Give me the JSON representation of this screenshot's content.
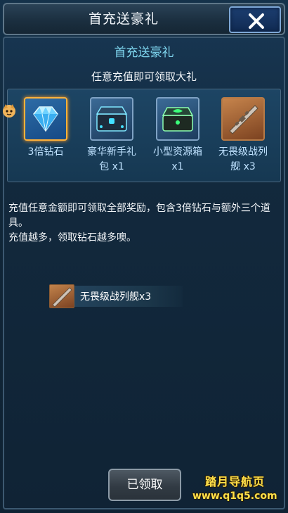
{
  "header": {
    "title": "首充送豪礼",
    "close_icon": "close-icon"
  },
  "main": {
    "subtitle": "首充送豪礼",
    "tagline": "任意充值即可领取大礼",
    "rewards": [
      {
        "label_line1": "3倍钻石",
        "label_line2": "",
        "icon": "diamond-icon",
        "selected": true
      },
      {
        "label_line1": "豪华新手礼",
        "label_line2": "包 x1",
        "icon": "blue-chest-icon",
        "selected": false
      },
      {
        "label_line1": "小型资源箱",
        "label_line2": "x1",
        "icon": "green-chest-icon",
        "selected": false
      },
      {
        "label_line1": "无畏级战列",
        "label_line2": "舰 x3",
        "icon": "battleship-icon",
        "selected": false
      }
    ],
    "description": {
      "line1": "充值任意金额即可领取全部奖励，包含3倍钻石与额外三个道具。",
      "line2": "充值越多，领取钻石越多噢。"
    },
    "detail_item": {
      "label": "无畏级战列舰x3",
      "icon": "battleship-icon"
    },
    "claimed_button": "已领取"
  },
  "watermark": {
    "line1": "踏月导航页",
    "line2": "www.q1q5.com"
  },
  "colors": {
    "accent_cyan": "#7fd6ef",
    "selected_border": "#ffb23a",
    "watermark": "#ffe04a"
  }
}
